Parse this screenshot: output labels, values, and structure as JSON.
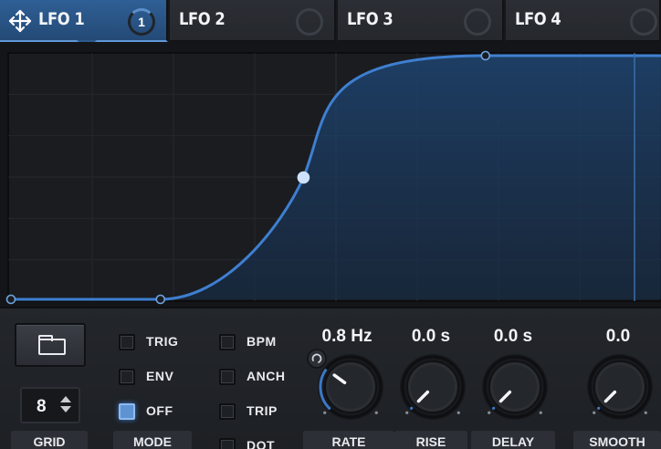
{
  "tabs": [
    {
      "label": "LFO 1",
      "active": true,
      "count": "1"
    },
    {
      "label": "LFO 2",
      "active": false
    },
    {
      "label": "LFO 3",
      "active": false
    },
    {
      "label": "LFO 4",
      "active": false
    }
  ],
  "icons": {
    "drag_handle": "four-arrows-move-icon",
    "folder": "folder-icon",
    "stepper": "up-down-arrows-icon",
    "link": "link-icon"
  },
  "colors": {
    "accent": "#3d78c4",
    "curve": "#3f7fd0",
    "active_tab": "#2f5f95",
    "background": "#1b1d21"
  },
  "graph": {
    "shape": "s-curve",
    "points": [
      {
        "x": 0.0,
        "y": 0.0
      },
      {
        "x": 0.23,
        "y": 0.0
      },
      {
        "x": 0.45,
        "y": 0.5
      },
      {
        "x": 0.73,
        "y": 1.0
      }
    ],
    "grid_divisions": 8
  },
  "controls": {
    "grid": {
      "value": "8",
      "label": "GRID"
    },
    "mode": {
      "label": "MODE",
      "options": [
        {
          "label": "TRIG",
          "checked": false
        },
        {
          "label": "ENV",
          "checked": false
        },
        {
          "label": "OFF",
          "checked": true
        }
      ]
    },
    "options2": [
      {
        "label": "BPM",
        "checked": false
      },
      {
        "label": "ANCH",
        "checked": false
      },
      {
        "label": "TRIP",
        "checked": false
      },
      {
        "label": "DOT",
        "checked": false
      }
    ],
    "knobs": [
      {
        "label": "RATE",
        "value": "0.8 Hz",
        "level": 0.3
      },
      {
        "label": "RISE",
        "value": "0.0 s",
        "level": 0.0
      },
      {
        "label": "DELAY",
        "value": "0.0 s",
        "level": 0.0
      },
      {
        "label": "SMOOTH",
        "value": "0.0",
        "level": 0.0
      }
    ]
  }
}
